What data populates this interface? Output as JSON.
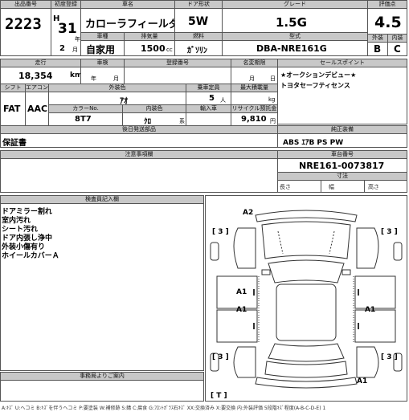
{
  "header": {
    "lot_label": "出品番号",
    "lot": "2223",
    "first_reg_label": "初度登録",
    "era_mark": "H",
    "year_num": "31",
    "year_unit": "年",
    "month_num": "2",
    "month_unit": "月",
    "car_name_label": "車名",
    "car_name": "カローラフィールダー",
    "doors_label": "ドア形状",
    "doors": "5W",
    "grade_label": "グレード",
    "grade": "1.5G",
    "score_label": "評価点",
    "score": "4.5",
    "vehicle_type_label": "車種",
    "vehicle_type": "自家用",
    "displacement_label": "排気量",
    "displacement": "1500",
    "displacement_unit": "cc",
    "fuel_label": "燃料",
    "fuel": "ｶﾞｿﾘﾝ",
    "model_label": "型式",
    "model": "DBA-NRE161G",
    "ext_label": "外装",
    "ext": "B",
    "int_label": "内装",
    "int": "C"
  },
  "row2": {
    "mileage_label": "走行",
    "mileage": "18,354",
    "mileage_unit": "km",
    "shaken_label": "車検",
    "shaken_year_unit": "年",
    "shaken_month_unit": "月",
    "reg_no_label": "登録番号",
    "name_change_label": "名変期限",
    "name_change_month_unit": "月",
    "name_change_day_unit": "日",
    "selling_label": "セールスポイント",
    "selling_points": [
      "★オークションデビュー★",
      "トヨタセーフティセンス"
    ]
  },
  "row3": {
    "shift_label": "シフト",
    "shift": "FAT",
    "ac_label": "エアコン",
    "ac": "AAC",
    "exterior_color_label": "外装色",
    "exterior_color": "ｱｵ",
    "capacity_label": "乗車定員",
    "capacity": "5",
    "capacity_unit": "人",
    "max_load_label": "最大積載量",
    "max_load_unit": "kg",
    "color_no_label": "カラーNo.",
    "color_no": "8T7",
    "interior_color_label": "内装色",
    "interior_color": "ｸﾛ",
    "interior_suffix": "系",
    "import_label": "輸入車",
    "recycle_label": "リサイクル預託金",
    "recycle": "9,810",
    "recycle_unit": "円"
  },
  "accessories": {
    "label": "後日発送部品",
    "value": "保証書"
  },
  "equipment": {
    "label": "純正装備",
    "value": "ABS ｴｱB PS PW"
  },
  "notes": {
    "label": "注意事項欄"
  },
  "chassis": {
    "label": "車台番号",
    "value": "NRE161-0073817",
    "dims_label": "寸法",
    "length_label": "長さ",
    "width_label": "幅",
    "height_label": "高さ"
  },
  "inspector": {
    "label": "検査員記入欄",
    "lines": [
      "ドアミラー割れ",
      "室内汚れ",
      "シート汚れ",
      "ドア内張し浄中",
      "外装小傷有り",
      "ホイールカバーＡ"
    ]
  },
  "office": {
    "label": "事務局よりご案内"
  },
  "diagram": {
    "marks": {
      "front_bumper": "A2",
      "front_left_tire": "[ 3 ]",
      "front_right_tire": "[ 3 ]",
      "left_front_door": "A1",
      "left_rear_door": "A1",
      "right_rear_door": "A1",
      "rear_left_tire": "[ 3 ]",
      "rear_right_tire": "[ 3 ]",
      "rear_bumper": "A1",
      "tail": "[ T ]"
    }
  },
  "footer": "A:ｷｽﾞ U:ヘコミ B:ｷｽﾞを伴うヘコミ P:要塗装 W:補修跡 S:錆 C:腐食 G:ﾌﾛﾝﾄｶﾞﾗｽ石ｷｽﾞ XX:交換済み X:要交換 内:外装評価 5段階ｷｽﾞ程度(A-B-C-D-E) 1"
}
